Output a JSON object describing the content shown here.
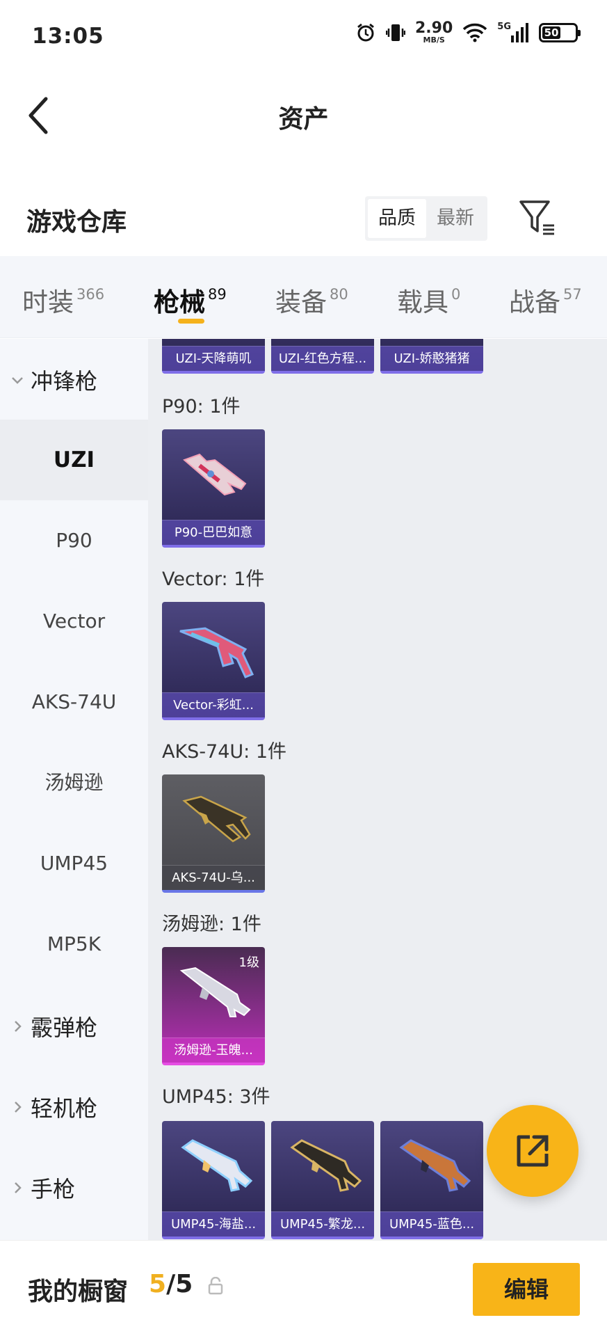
{
  "status": {
    "time": "13:05",
    "net_speed": "2.90",
    "net_unit": "MB/S",
    "signal": "5G",
    "battery": "50"
  },
  "header": {
    "title": "资产"
  },
  "warehouse": {
    "title": "游戏仓库",
    "sort_options": [
      "品质",
      "最新"
    ],
    "sort_selected": "品质"
  },
  "tabs": [
    {
      "label": "时装",
      "count": "366"
    },
    {
      "label": "枪械",
      "count": "89",
      "active": true
    },
    {
      "label": "装备",
      "count": "80"
    },
    {
      "label": "载具",
      "count": "0"
    },
    {
      "label": "战备",
      "count": "57"
    }
  ],
  "sidebar": {
    "cat1": "冲锋枪",
    "items": [
      "UZI",
      "P90",
      "Vector",
      "AKS-74U",
      "汤姆逊",
      "UMP45",
      "MP5K"
    ],
    "active_item": "UZI",
    "cat2": "霰弹枪",
    "cat3": "轻机枪",
    "cat4": "手枪"
  },
  "content": {
    "uzi_items": [
      "UZI-天降萌叽",
      "UZI-红色方程...",
      "UZI-娇憨猪猪"
    ],
    "groups": [
      {
        "title": "P90: 1件",
        "items": [
          "P90-巴巴如意"
        ]
      },
      {
        "title": "Vector: 1件",
        "items": [
          "Vector-彩虹..."
        ]
      },
      {
        "title": "AKS-74U: 1件",
        "items": [
          "AKS-74U-乌..."
        ]
      },
      {
        "title": "汤姆逊: 1件",
        "items": [
          "汤姆逊-玉魄..."
        ],
        "level": "1级"
      },
      {
        "title": "UMP45: 3件",
        "items": [
          "UMP45-海盐...",
          "UMP45-繁龙...",
          "UMP45-蓝色..."
        ]
      }
    ]
  },
  "showcase": {
    "label": "我的橱窗",
    "count_current": "5",
    "count_sep": "/",
    "count_total": "5",
    "edit_label": "编辑"
  },
  "colors": {
    "accent": "#f8b418",
    "card_purple": "#3a3466",
    "card_pink": "#b92fb6",
    "card_grey": "#55555a"
  }
}
